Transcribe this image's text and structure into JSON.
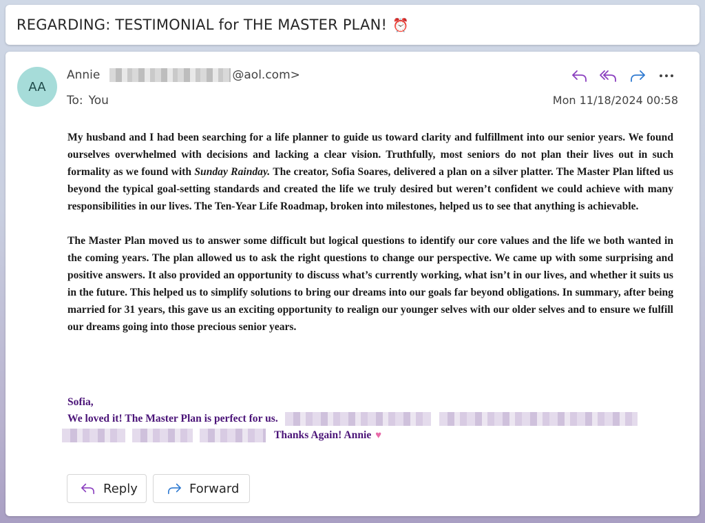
{
  "subject": {
    "title": "REGARDING:  TESTIMONIAL for THE MASTER PLAN!",
    "emoji": "⏰"
  },
  "message": {
    "avatar_initials": "AA",
    "from_name": "Annie",
    "from_domain": "@aol.com>",
    "to_label": "To:",
    "to_value": "You",
    "date": "Mon 11/18/2024 00:58",
    "actions": {
      "reply_icon": "reply-icon",
      "reply_all_icon": "reply-all-icon",
      "forward_icon": "forward-icon",
      "more_icon": "more-icon"
    },
    "body": {
      "p1_before": "My husband and I had been searching for a life planner to guide us toward clarity and fulfillment into our senior years.  We found ourselves overwhelmed with decisions and lacking a clear vision. Truthfully, most seniors do not plan their lives out in such formality as we found with ",
      "p1_italic": "Sunday Rainday.",
      "p1_after": "  The creator, Sofia Soares, delivered a plan on a silver platter. The Master Plan lifted us beyond the typical goal-setting standards and created the life we truly desired but weren’t confident we could achieve with many responsibilities in our lives.  The Ten-Year Life Roadmap, broken into milestones, helped us to see that anything is achievable.",
      "p2": "The Master Plan moved us to answer some difficult but logical questions to identify our core values and the life we both wanted in the coming years. The plan allowed us to ask the right questions to change our perspective.  We came up with some surprising and positive answers. It also provided an opportunity to discuss what’s currently working, what isn’t in our lives, and whether it suits us in the future. This helped us to simplify solutions to bring our dreams into our goals far beyond obligations. In summary, after being married for 31 years, this gave us an exciting opportunity to realign our younger selves with our older selves and to ensure we fulfill our dreams going into those precious senior years."
    },
    "signature": {
      "line1": "Sofia,",
      "line2": "We loved it!  The Master Plan is perfect for us.",
      "line3": "Thanks Again!  Annie",
      "heart": "♥",
      "color": "#4b1478"
    }
  },
  "buttons": {
    "reply_label": "Reply",
    "forward_label": "Forward"
  },
  "colors": {
    "reply_accent": "#8a3fbf",
    "forward_accent": "#2f7ad1",
    "avatar_bg": "#a6dcd9"
  }
}
